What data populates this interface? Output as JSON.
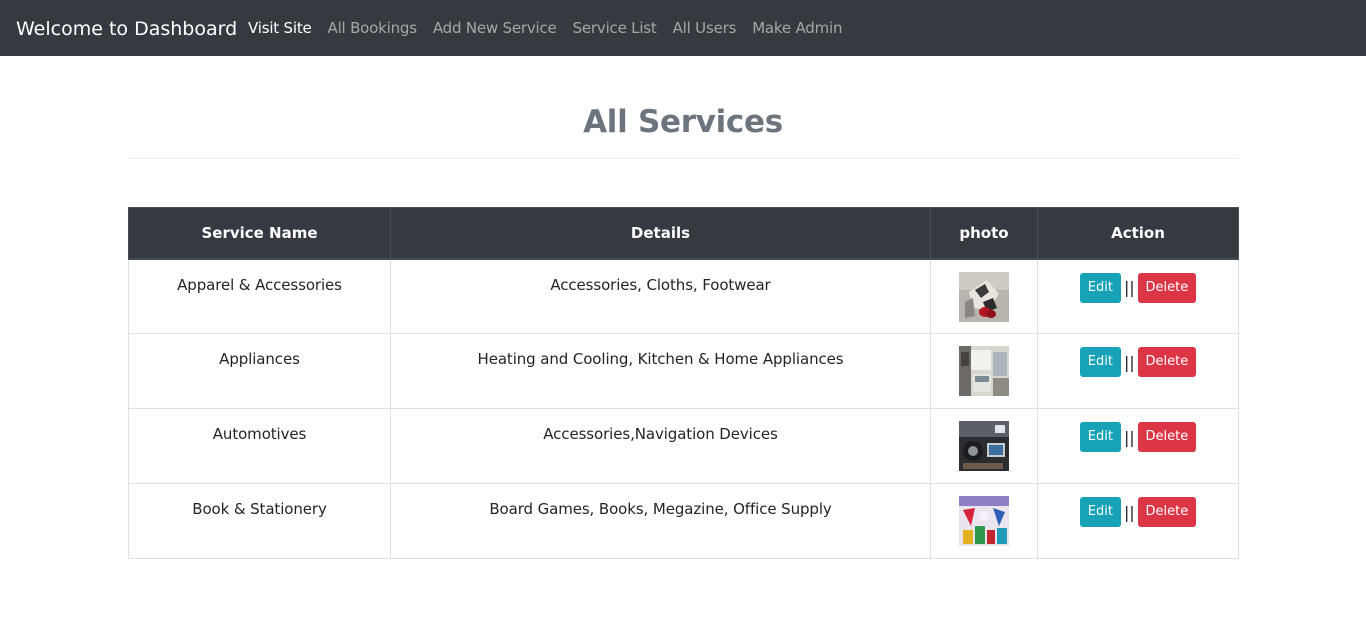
{
  "navbar": {
    "brand": "Welcome to Dashboard",
    "links": [
      {
        "label": "Visit Site",
        "active": true
      },
      {
        "label": "All Bookings",
        "active": false
      },
      {
        "label": "Add New Service",
        "active": false
      },
      {
        "label": "Service List",
        "active": false
      },
      {
        "label": "All Users",
        "active": false
      },
      {
        "label": "Make Admin",
        "active": false
      }
    ]
  },
  "page": {
    "title": "All Services"
  },
  "table": {
    "headers": [
      "Service Name",
      "Details",
      "photo",
      "Action"
    ],
    "rows": [
      {
        "name": "Apparel & Accessories",
        "details": "Accessories, Cloths, Footwear",
        "photo_icon": "apparel-photo",
        "edit": "Edit",
        "separator": "||",
        "delete": "Delete"
      },
      {
        "name": "Appliances",
        "details": "Heating and Cooling, Kitchen & Home Appliances",
        "photo_icon": "appliances-photo",
        "edit": "Edit",
        "separator": "||",
        "delete": "Delete"
      },
      {
        "name": "Automotives",
        "details": "Accessories,Navigation Devices",
        "photo_icon": "automotives-photo",
        "edit": "Edit",
        "separator": "||",
        "delete": "Delete"
      },
      {
        "name": "Book & Stationery",
        "details": "Board Games, Books, Megazine, Office Supply",
        "photo_icon": "book-stationery-photo",
        "edit": "Edit",
        "separator": "||",
        "delete": "Delete"
      }
    ]
  },
  "colors": {
    "navbar_bg": "#343a40",
    "title": "#6c757d",
    "edit_button": "#17a2b8",
    "delete_button": "#dc3545"
  }
}
